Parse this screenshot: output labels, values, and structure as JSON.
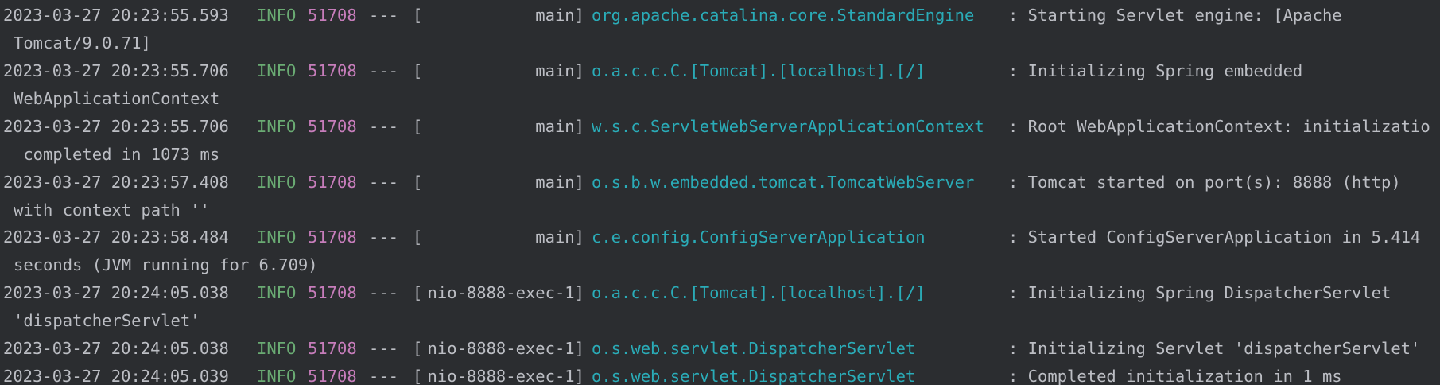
{
  "colors": {
    "background": "#2b2d30",
    "text": "#bcbec4",
    "info": "#6aab73",
    "pid": "#c77dbb",
    "logger": "#2aacb8"
  },
  "log": {
    "entries": [
      {
        "timestamp": "2023-03-27 20:23:55.593",
        "level": "INFO",
        "pid": "51708",
        "separator": "---",
        "thread": "main",
        "logger": "org.apache.catalina.core.StandardEngine",
        "message": ": Starting Servlet engine: [Apache",
        "continuation": "Tomcat/9.0.71]"
      },
      {
        "timestamp": "2023-03-27 20:23:55.706",
        "level": "INFO",
        "pid": "51708",
        "separator": "---",
        "thread": "main",
        "logger": "o.a.c.c.C.[Tomcat].[localhost].[/]",
        "message": ": Initializing Spring embedded",
        "continuation": "WebApplicationContext"
      },
      {
        "timestamp": "2023-03-27 20:23:55.706",
        "level": "INFO",
        "pid": "51708",
        "separator": "---",
        "thread": "main",
        "logger": "w.s.c.ServletWebServerApplicationContext",
        "message": ": Root WebApplicationContext: initializatio",
        "continuation": " completed in 1073 ms"
      },
      {
        "timestamp": "2023-03-27 20:23:57.408",
        "level": "INFO",
        "pid": "51708",
        "separator": "---",
        "thread": "main",
        "logger": "o.s.b.w.embedded.tomcat.TomcatWebServer",
        "message": ": Tomcat started on port(s): 8888 (http)",
        "continuation": "with context path ''"
      },
      {
        "timestamp": "2023-03-27 20:23:58.484",
        "level": "INFO",
        "pid": "51708",
        "separator": "---",
        "thread": "main",
        "logger": "c.e.config.ConfigServerApplication",
        "message": ": Started ConfigServerApplication in 5.414",
        "continuation": "seconds (JVM running for 6.709)"
      },
      {
        "timestamp": "2023-03-27 20:24:05.038",
        "level": "INFO",
        "pid": "51708",
        "separator": "---",
        "thread": "nio-8888-exec-1",
        "logger": "o.a.c.c.C.[Tomcat].[localhost].[/]",
        "message": ": Initializing Spring DispatcherServlet",
        "continuation": "'dispatcherServlet'"
      },
      {
        "timestamp": "2023-03-27 20:24:05.038",
        "level": "INFO",
        "pid": "51708",
        "separator": "---",
        "thread": "nio-8888-exec-1",
        "logger": "o.s.web.servlet.DispatcherServlet",
        "message": ": Initializing Servlet 'dispatcherServlet'",
        "continuation": ""
      },
      {
        "timestamp": "2023-03-27 20:24:05.039",
        "level": "INFO",
        "pid": "51708",
        "separator": "---",
        "thread": "nio-8888-exec-1",
        "logger": "o.s.web.servlet.DispatcherServlet",
        "message": ": Completed initialization in 1 ms",
        "continuation": ""
      }
    ]
  }
}
